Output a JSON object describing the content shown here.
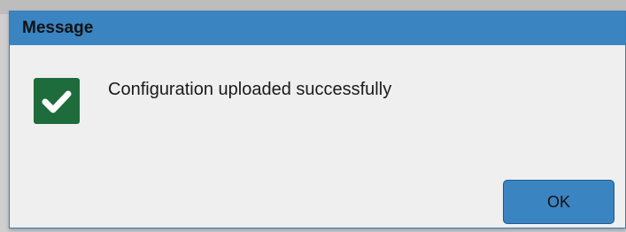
{
  "dialog": {
    "title": "Message",
    "icon": "check-icon",
    "message": "Configuration uploaded successfully",
    "ok_label": "OK"
  },
  "colors": {
    "titlebar": "#3a84c1",
    "body": "#efefef",
    "success_icon_bg": "#1e6b3b",
    "button": "#3a84c1"
  }
}
